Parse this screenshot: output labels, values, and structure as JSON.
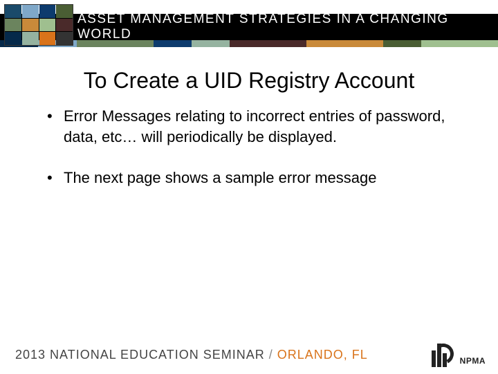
{
  "header": {
    "title": "ASSET MANAGEMENT STRATEGIES IN A CHANGING WORLD"
  },
  "slide": {
    "title": "To Create a UID Registry Account",
    "bullets": [
      "Error Messages relating to incorrect entries of password, data, etc… will periodically be displayed.",
      "The next page shows a sample error message"
    ]
  },
  "footer": {
    "line1": "2013 NATIONAL EDUCATION SEMINAR",
    "sep": "/",
    "location": "ORLANDO, FL",
    "logo_text": "NPMA"
  },
  "thumb_colors": [
    "#1a4a6a",
    "#7fa8c9",
    "#0d3b6d",
    "#4a5e34",
    "#6b845e",
    "#c98a3a",
    "#9fbf8f",
    "#4a2a2a",
    "#05294a",
    "#95b3a0",
    "#d9731a",
    "#333"
  ]
}
